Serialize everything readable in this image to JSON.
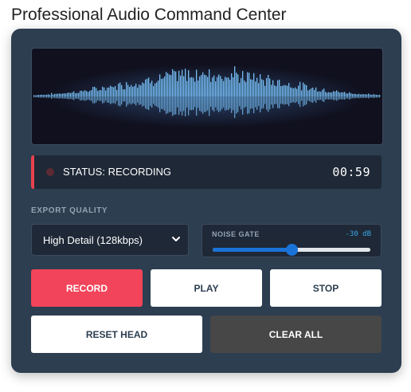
{
  "page": {
    "title": "Professional Audio Command Center"
  },
  "status": {
    "label": "STATUS: RECORDING",
    "time": "00:59"
  },
  "export": {
    "label": "EXPORT QUALITY",
    "selected": "High Detail (128kbps)"
  },
  "noise_gate": {
    "label": "NOISE GATE",
    "value": "-30 dB",
    "level": 0.5
  },
  "buttons": {
    "record": "RECORD",
    "play": "PLAY",
    "stop": "STOP",
    "reset": "RESET HEAD",
    "clear": "CLEAR ALL"
  },
  "colors": {
    "panel": "#2c3e50",
    "record": "#f2445a",
    "clear": "#474747",
    "accent_blue": "#1a73d9",
    "wave_start": "#a26bff",
    "wave_end": "#3fe0d0"
  },
  "icons": {
    "status": "status-dot-icon",
    "select": "chevron-down-icon"
  }
}
